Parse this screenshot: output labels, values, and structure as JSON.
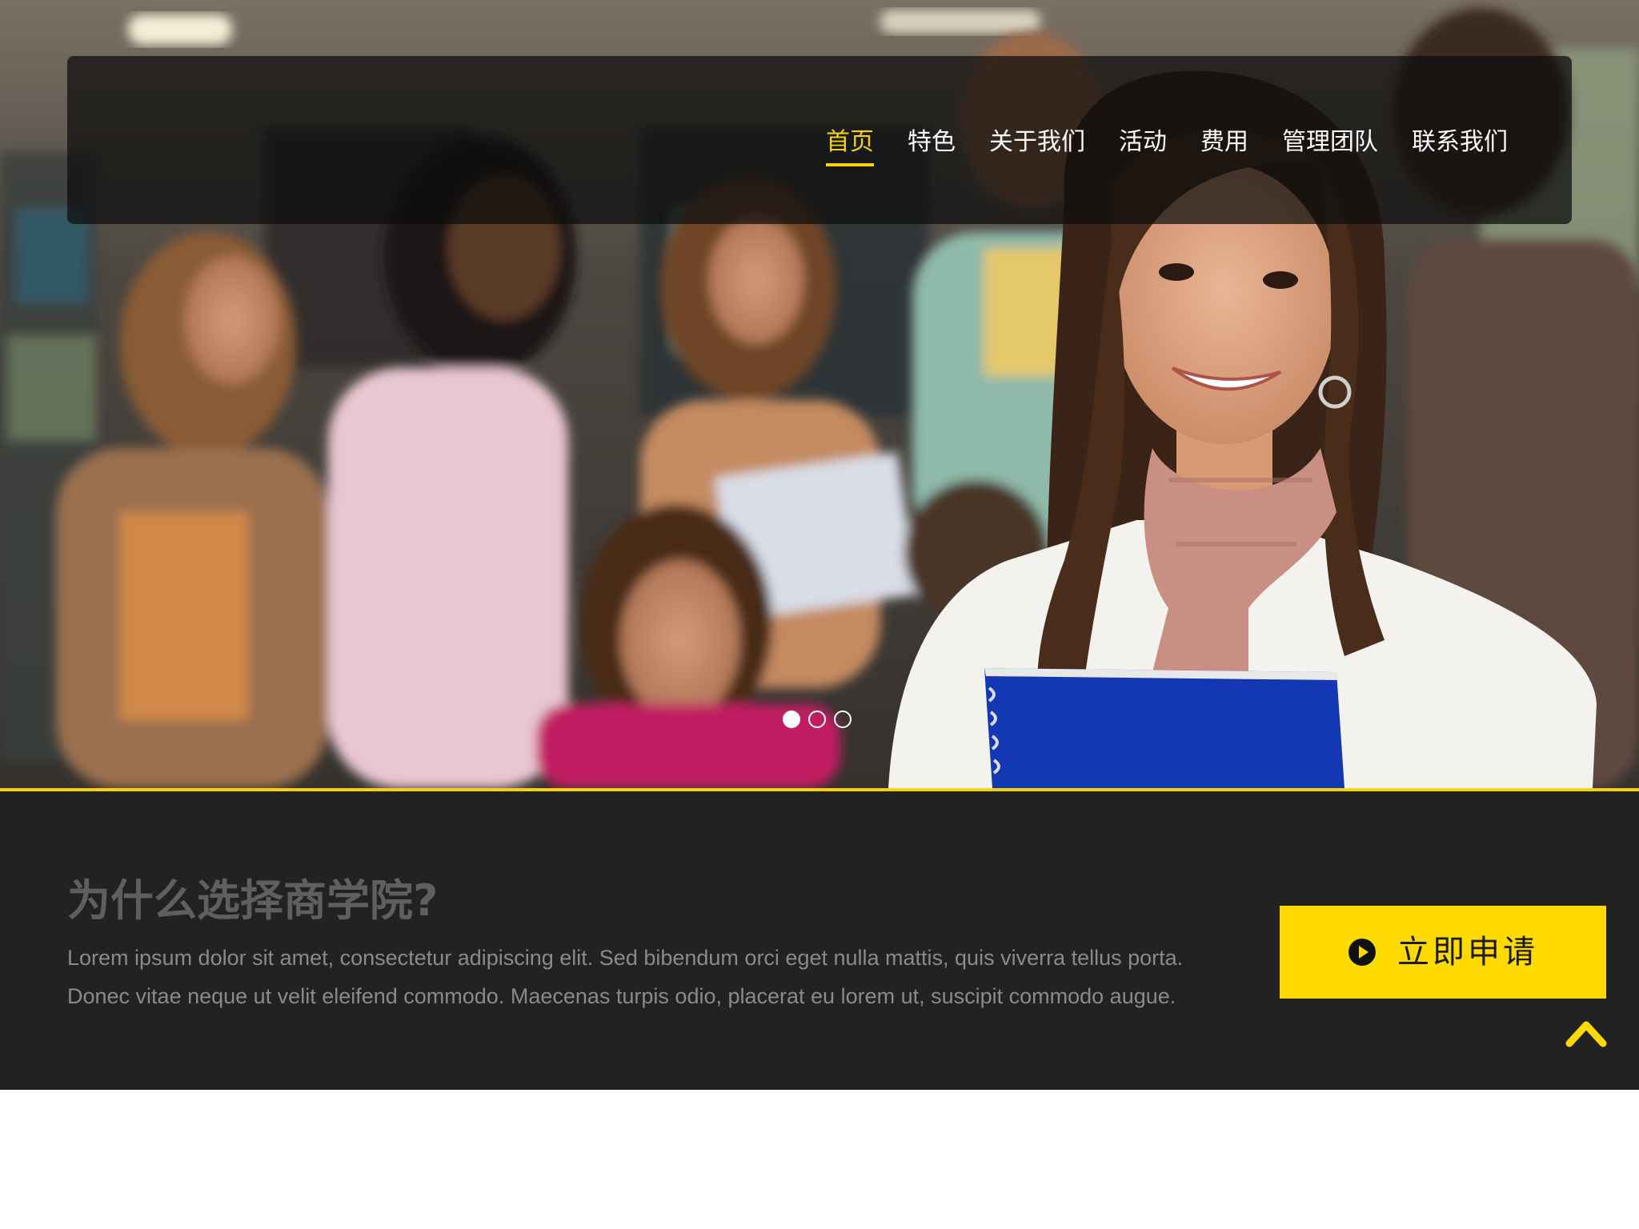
{
  "nav": {
    "items": [
      {
        "label": "首页",
        "active": true
      },
      {
        "label": "特色",
        "active": false
      },
      {
        "label": "关于我们",
        "active": false
      },
      {
        "label": "活动",
        "active": false
      },
      {
        "label": "费用",
        "active": false
      },
      {
        "label": "管理团队",
        "active": false
      },
      {
        "label": "联系我们",
        "active": false
      }
    ]
  },
  "slider": {
    "slide_count": 3,
    "active_index": 0
  },
  "intro": {
    "title": "为什么选择商学院?",
    "text": "Lorem ipsum dolor sit amet, consectetur adipiscing elit. Sed bibendum orci eget nulla mattis, quis viverra tellus porta. Donec vitae neque ut velit eleifend commodo. Maecenas turpis odio, placerat eu lorem ut, suscipit commodo augue.",
    "apply_label": "立即申请",
    "apply_icon": "play-circle-icon",
    "back_to_top_icon": "chevron-up-icon"
  },
  "colors": {
    "accent": "#ffda00",
    "band_background": "#222222",
    "nav_active": "#f6d20b"
  }
}
